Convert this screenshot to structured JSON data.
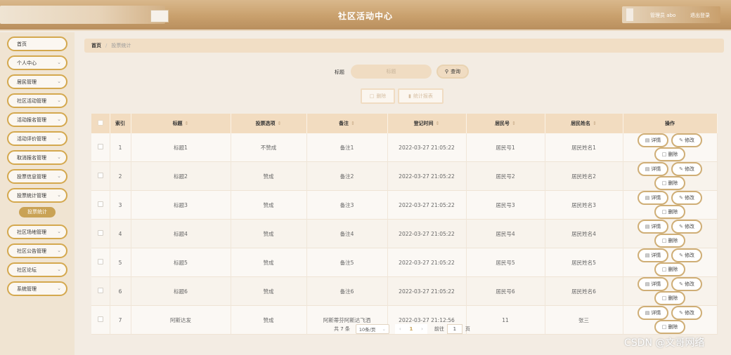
{
  "header": {
    "title": "社区活动中心",
    "admin_label": "管理员 abo",
    "logout_label": "退出登录"
  },
  "sidebar": {
    "items": [
      {
        "label": "首页",
        "chevron": false
      },
      {
        "label": "个人中心",
        "chevron": true
      },
      {
        "label": "居民管理",
        "chevron": true
      },
      {
        "label": "社区活动管理",
        "chevron": true
      },
      {
        "label": "活动报名管理",
        "chevron": true
      },
      {
        "label": "活动评价管理",
        "chevron": true
      },
      {
        "label": "取消报名管理",
        "chevron": true
      },
      {
        "label": "投票信息管理",
        "chevron": true
      },
      {
        "label": "投票统计管理",
        "chevron": true
      },
      {
        "label": "社区场地管理",
        "chevron": true
      },
      {
        "label": "社区公告管理",
        "chevron": true
      },
      {
        "label": "社区论坛",
        "chevron": true
      },
      {
        "label": "系统管理",
        "chevron": true
      }
    ],
    "active_sub": "投票统计"
  },
  "breadcrumb": {
    "home": "首页",
    "separator": "/",
    "current": "投票统计"
  },
  "search": {
    "label": "标题",
    "placeholder": "标题",
    "button": "查询"
  },
  "actions": {
    "delete": "删除",
    "report": "统计报表"
  },
  "table": {
    "columns": [
      "索引",
      "标题",
      "投票选项",
      "备注",
      "登记时间",
      "居民号",
      "居民姓名",
      "操作"
    ],
    "rows": [
      [
        "1",
        "标题1",
        "不赞成",
        "备注1",
        "2022-03-27 21:05:22",
        "居民号1",
        "居民姓名1"
      ],
      [
        "2",
        "标题2",
        "赞成",
        "备注2",
        "2022-03-27 21:05:22",
        "居民号2",
        "居民姓名2"
      ],
      [
        "3",
        "标题3",
        "赞成",
        "备注3",
        "2022-03-27 21:05:22",
        "居民号3",
        "居民姓名3"
      ],
      [
        "4",
        "标题4",
        "赞成",
        "备注4",
        "2022-03-27 21:05:22",
        "居民号4",
        "居民姓名4"
      ],
      [
        "5",
        "标题5",
        "赞成",
        "备注5",
        "2022-03-27 21:05:22",
        "居民号5",
        "居民姓名5"
      ],
      [
        "6",
        "标题6",
        "赞成",
        "备注6",
        "2022-03-27 21:05:22",
        "居民号6",
        "居民姓名6"
      ],
      [
        "7",
        "阿斯达发",
        "赞成",
        "阿斯蒂芬阿斯达飞洒",
        "2022-03-27 21:12:56",
        "11",
        "张三"
      ]
    ],
    "op_labels": {
      "detail": "详情",
      "edit": "修改",
      "delete": "删除"
    }
  },
  "pagination": {
    "total": "共 7 条",
    "page_size": "10条/页",
    "current_page": "1",
    "goto_label": "前往",
    "goto_value": "1",
    "page_suffix": "页"
  },
  "watermark": "CSDN @文哥网络",
  "colors": {
    "accent": "#c9a255",
    "header": "#c9a06d",
    "table_head": "#f2dcc0"
  }
}
